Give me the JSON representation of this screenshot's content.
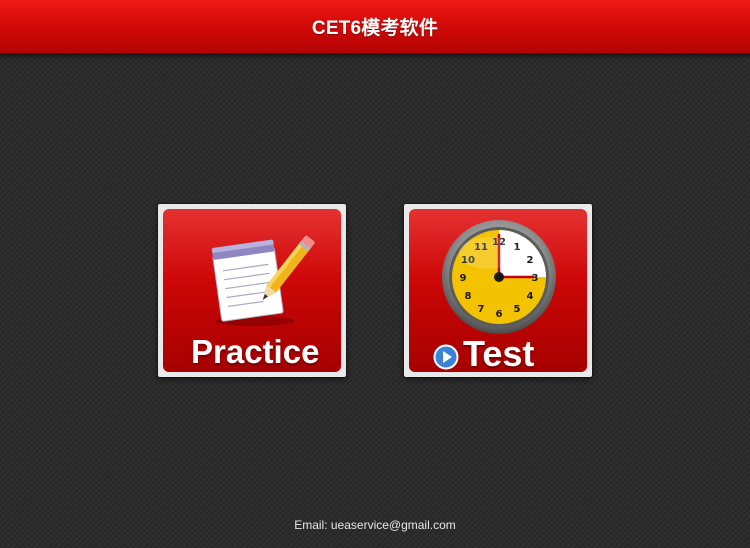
{
  "header": {
    "title": "CET6模考软件"
  },
  "tiles": {
    "practice": {
      "label": "Practice",
      "icon": "notepad-pencil-icon"
    },
    "test": {
      "label": "Test",
      "icon": "clock-icon",
      "play_icon": "play-icon"
    }
  },
  "footer": {
    "email_text": "Email: ueaservice@gmail.com"
  },
  "colors": {
    "accent": "#d30a08",
    "background": "#2c2c2c",
    "tile_border": "#e9e9e9",
    "clock_face": "#f3c200"
  }
}
